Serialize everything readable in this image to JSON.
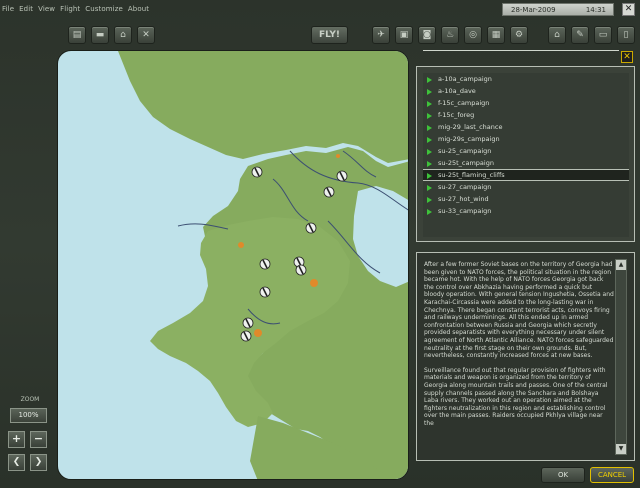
{
  "menu": [
    "File",
    "Edit",
    "View",
    "Flight",
    "Customize",
    "About"
  ],
  "datetime": {
    "date": "28-Mar-2009",
    "time": "14:31"
  },
  "window_close_label": "✕",
  "toolbar": {
    "left_icons": [
      "open-folder-icon",
      "save-icon",
      "print-icon",
      "tools-icon"
    ],
    "fly_label": "FLY!",
    "mid_icons": [
      "aircraft-icon",
      "lock-icon",
      "camera-icon",
      "flame-icon",
      "target-icon",
      "chart-icon",
      "gear-icon"
    ],
    "right_icons": [
      "home-icon",
      "wrench-icon",
      "briefcase-icon",
      "page-icon"
    ]
  },
  "panel_close_label": "✕",
  "zoom": {
    "label": "ZOOM",
    "value": "100%",
    "plus": "+",
    "minus": "−",
    "left": "❮",
    "right": "❯"
  },
  "campaigns": {
    "items": [
      "a-10a_campaign",
      "a-10a_dave",
      "f-15c_campaign",
      "f-15c_foreg",
      "mig-29_last_chance",
      "mig-29s_campaign",
      "su-25_campaign",
      "su-25t_campaign",
      "su-25t_flaming_cliffs",
      "su-27_campaign",
      "su-27_hot_wind",
      "su-33_campaign"
    ],
    "selected_index": 8
  },
  "briefing": {
    "paragraphs": [
      "After a few former Soviet bases on the territory of Georgia had been given to NATO forces, the political situation in the region became hot. With the help of NATO forces Georgia got back the control over Abkhazia having performed a quick but bloody operation. With general tension Ingushetia, Ossetia and Karachai-Circassia were added to the long-lasting war in Chechnya. There began constant terrorist acts, convoys firing and railways underminings. All this ended up in armed confrontation between Russia and Georgia which secretly provided separatists with everything necessary under silent agreement of North Atlantic Alliance. NATO forces safeguarded neutrality at the first stage on their own grounds. But, nevertheless, constantly increased forces at new bases.",
      "Surveillance found out that regular provision of fighters with materials and weapon is organized from the territory of Georgia along mountain trails and passes. One of the central supply channels passed along the Sanchara and Bolshaya Laba rivers. They worked out an operation aimed at the fighters neutralization in this region and establishing control over the main passes. Raiders occupied Pkhlya village near the"
    ],
    "scroll_up": "▲",
    "scroll_down": "▼"
  },
  "buttons": {
    "ok": "OK",
    "cancel": "CANCEL"
  },
  "colors": {
    "land": "#7fa55a",
    "sea": "#bfe2ea",
    "marker": "#eef1ee",
    "accent": "#e2c000"
  }
}
